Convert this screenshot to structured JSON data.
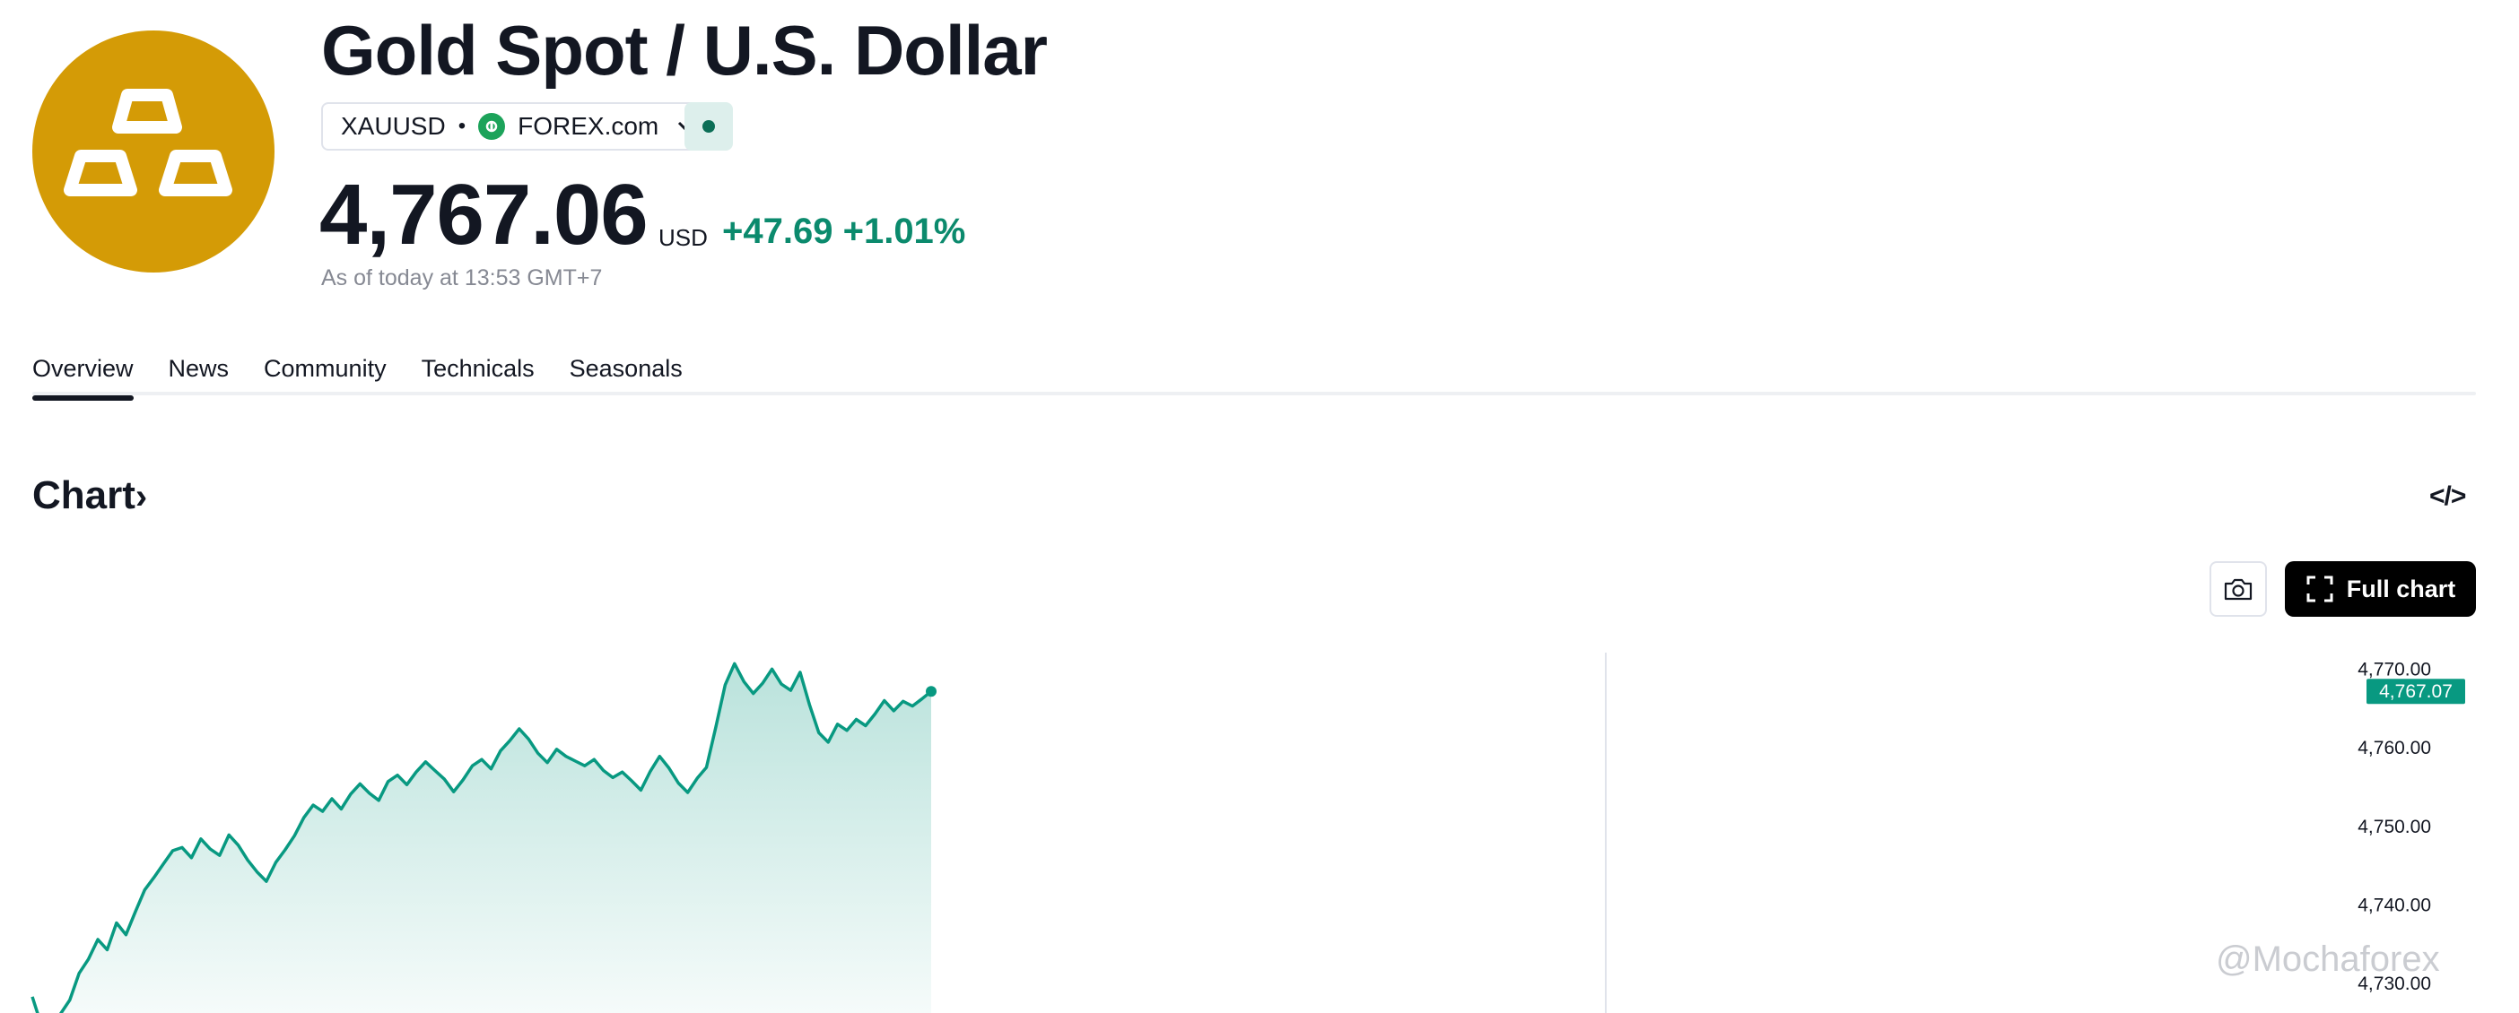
{
  "header": {
    "title": "Gold Spot / U.S. Dollar",
    "symbol": "XAUUSD",
    "separator": "•",
    "exchange": "FOREX.com",
    "price": "4,767.06",
    "currency": "USD",
    "change_abs": "+47.69",
    "change_pct": "+1.01%",
    "as_of": "As of today at 13:53 GMT+7",
    "logo_color": "#d49b06",
    "change_color": "#0b8a6d"
  },
  "tabs": [
    {
      "label": "Overview",
      "active": true
    },
    {
      "label": "News",
      "active": false
    },
    {
      "label": "Community",
      "active": false
    },
    {
      "label": "Technicals",
      "active": false
    },
    {
      "label": "Seasonals",
      "active": false
    }
  ],
  "chart_section": {
    "heading": "Chart",
    "heading_arrow": "›",
    "embed_label": "</>",
    "full_chart_label": "Full chart",
    "watermark": "@Mochaforex"
  },
  "chart_data": {
    "type": "area",
    "series": [
      {
        "values": [
          4728.2,
          4724.5,
          4725.1,
          4726.0,
          4727.8,
          4731.2,
          4733.0,
          4735.5,
          4734.2,
          4737.6,
          4736.1,
          4739.0,
          4741.8,
          4743.4,
          4745.1,
          4746.8,
          4747.2,
          4745.9,
          4748.3,
          4747.0,
          4746.2,
          4748.8,
          4747.5,
          4745.6,
          4744.1,
          4742.9,
          4745.3,
          4746.9,
          4748.7,
          4751.0,
          4752.6,
          4751.8,
          4753.4,
          4752.1,
          4754.0,
          4755.3,
          4754.1,
          4753.2,
          4755.6,
          4756.4,
          4755.2,
          4756.8,
          4758.1,
          4757.0,
          4755.9,
          4754.3,
          4755.8,
          4757.6,
          4758.4,
          4757.2,
          4759.5,
          4760.8,
          4762.3,
          4761.0,
          4759.2,
          4758.0,
          4759.7,
          4758.8,
          4758.2,
          4757.6,
          4758.4,
          4757.0,
          4756.1,
          4756.8,
          4755.7,
          4754.5,
          4756.9,
          4758.8,
          4757.3,
          4755.4,
          4754.2,
          4756.0,
          4757.4,
          4762.5,
          4767.9,
          4770.6,
          4768.3,
          4766.8,
          4768.1,
          4769.9,
          4768.0,
          4767.2,
          4769.5,
          4765.4,
          4761.8,
          4760.6,
          4762.9,
          4762.1,
          4763.5,
          4762.7,
          4764.2,
          4765.9,
          4764.6,
          4765.8,
          4765.2,
          4766.1,
          4767.07
        ]
      }
    ],
    "ylim": [
      4725,
      4772
    ],
    "y_ticks": [
      "4,770.00",
      "4,760.00",
      "4,750.00",
      "4,740.00",
      "4,730.00"
    ],
    "last_value_label": "4,767.07",
    "line_color": "#089981",
    "grid": false,
    "legend": "none"
  }
}
